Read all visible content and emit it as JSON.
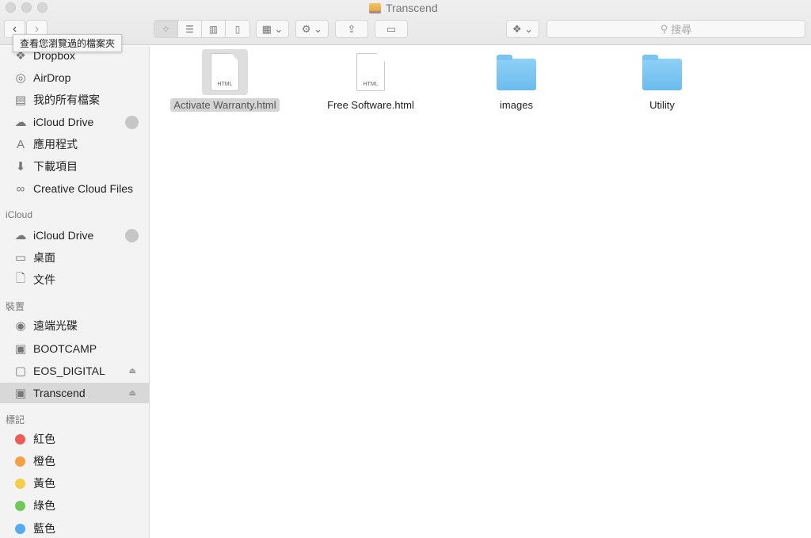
{
  "window": {
    "title": "Transcend"
  },
  "toolbar": {
    "search_placeholder": "搜尋",
    "tooltip": "查看您瀏覽過的檔案夾"
  },
  "sidebar": {
    "favorites": [
      {
        "label": "Dropbox",
        "icon": "dropbox-icon",
        "glyph": "❖"
      },
      {
        "label": "AirDrop",
        "icon": "airdrop-icon",
        "glyph": "◎"
      },
      {
        "label": "我的所有檔案",
        "icon": "all-files-icon",
        "glyph": "▤"
      },
      {
        "label": "iCloud Drive",
        "icon": "cloud-icon",
        "glyph": "☁"
      },
      {
        "label": "應用程式",
        "icon": "applications-icon",
        "glyph": "A"
      },
      {
        "label": "下載項目",
        "icon": "downloads-icon",
        "glyph": "⬇"
      },
      {
        "label": "Creative Cloud Files",
        "icon": "creative-cloud-icon",
        "glyph": "∞"
      }
    ],
    "icloud_header": "iCloud",
    "icloud": [
      {
        "label": "iCloud Drive",
        "icon": "cloud-icon",
        "glyph": "☁"
      },
      {
        "label": "桌面",
        "icon": "desktop-icon",
        "glyph": "▭"
      },
      {
        "label": "文件",
        "icon": "documents-icon",
        "glyph": "🗋"
      }
    ],
    "devices_header": "裝置",
    "devices": [
      {
        "label": "遠端光碟",
        "icon": "disc-icon",
        "glyph": "◉"
      },
      {
        "label": "BOOTCAMP",
        "icon": "drive-icon",
        "glyph": "▣"
      },
      {
        "label": "EOS_DIGITAL",
        "icon": "drive-icon",
        "glyph": "▢"
      },
      {
        "label": "Transcend",
        "icon": "drive-icon",
        "glyph": "▣"
      }
    ],
    "tags_header": "標記",
    "tags": [
      {
        "label": "紅色",
        "color": "#ee5d55"
      },
      {
        "label": "橙色",
        "color": "#f2a144"
      },
      {
        "label": "黃色",
        "color": "#f5cd4b"
      },
      {
        "label": "綠色",
        "color": "#71c85a"
      },
      {
        "label": "藍色",
        "color": "#56aaf0"
      }
    ]
  },
  "files": [
    {
      "name": "Activate Warranty.html",
      "type": "html",
      "type_label": "HTML",
      "selected": true
    },
    {
      "name": "Free Software.html",
      "type": "html",
      "type_label": "HTML",
      "selected": false
    },
    {
      "name": "images",
      "type": "folder"
    },
    {
      "name": "Utility",
      "type": "folder"
    }
  ]
}
